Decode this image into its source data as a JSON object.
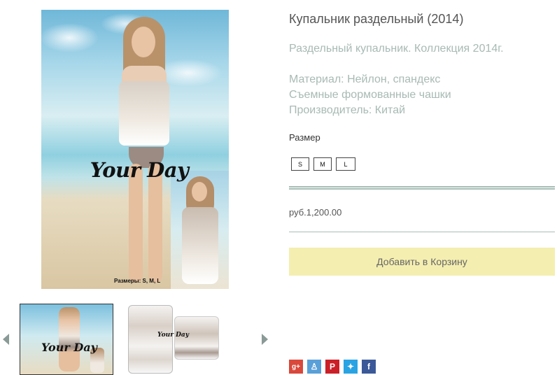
{
  "product": {
    "title": "Купальник раздельный (2014)",
    "description": "Раздельный купальник. Коллекция 2014г.",
    "specs": [
      "Материал: Нейлон, спандекс",
      "Съемные формованные чашки",
      "Производитель: Китай"
    ],
    "size_label": "Размер",
    "sizes": [
      "S",
      "M",
      "L"
    ],
    "price": "руб.1,200.00",
    "add_to_cart": "Добавить в Корзину"
  },
  "gallery": {
    "logo_text": "Your Day",
    "sizes_caption": "Размеры: S, M, L",
    "thumb2_logo": "Your Day"
  },
  "social": {
    "icons": [
      "google-plus-icon",
      "odnoklassniki-icon",
      "pinterest-icon",
      "twitter-icon",
      "facebook-icon"
    ]
  },
  "colors": {
    "accent_line": "#a7bdb6",
    "cart_button_bg": "#f4eeb0",
    "muted_text": "#a8bab5"
  }
}
